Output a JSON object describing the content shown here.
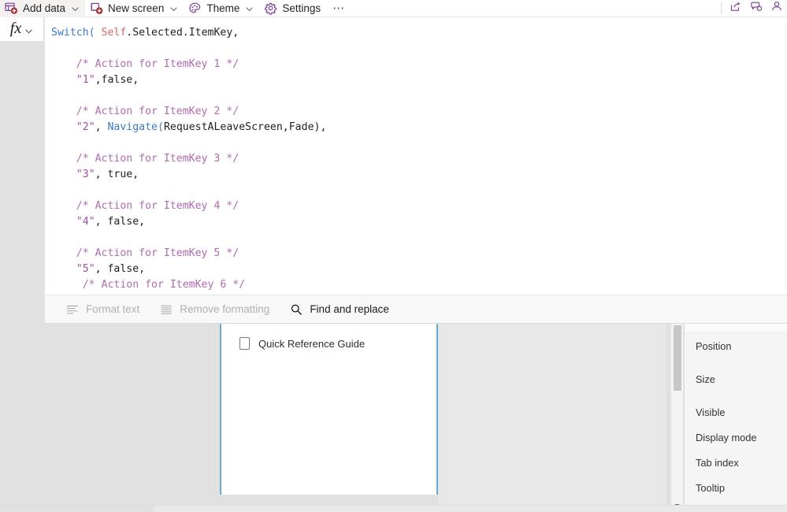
{
  "commandbar": {
    "items": [
      {
        "label": "Add data",
        "icon": "add-data-icon",
        "has_chevron": true
      },
      {
        "label": "New screen",
        "icon": "new-screen-icon",
        "has_chevron": true
      },
      {
        "label": "Theme",
        "icon": "theme-palette-icon",
        "has_chevron": true
      },
      {
        "label": "Settings",
        "icon": "settings-gear-icon",
        "has_chevron": false
      }
    ],
    "overflow": "⋯",
    "right_icons": [
      {
        "name": "share-icon"
      },
      {
        "name": "comments-icon"
      },
      {
        "name": "account-icon"
      }
    ]
  },
  "formula_bar": {
    "fx_label": "fx",
    "expand_chevron": "chevron-down-icon",
    "lines": [
      [
        {
          "t": "Switch(",
          "c": "fn"
        },
        {
          "t": " ",
          "c": "plain"
        },
        {
          "t": "Self",
          "c": "self"
        },
        {
          "t": ".Selected.ItemKey,",
          "c": "plain"
        }
      ],
      [],
      [
        {
          "t": "    /* Action for ItemKey 1 */",
          "c": "cmt"
        }
      ],
      [
        {
          "t": "    ",
          "c": "plain"
        },
        {
          "t": "\"1\"",
          "c": "str"
        },
        {
          "t": ",false,",
          "c": "plain"
        }
      ],
      [],
      [
        {
          "t": "    /* Action for ItemKey 2 */",
          "c": "cmt"
        }
      ],
      [
        {
          "t": "    ",
          "c": "plain"
        },
        {
          "t": "\"2\"",
          "c": "str"
        },
        {
          "t": ", ",
          "c": "plain"
        },
        {
          "t": "Navigate(",
          "c": "fn"
        },
        {
          "t": "RequestALeaveScreen,Fade),",
          "c": "plain"
        }
      ],
      [],
      [
        {
          "t": "    /* Action for ItemKey 3 */",
          "c": "cmt"
        }
      ],
      [
        {
          "t": "    ",
          "c": "plain"
        },
        {
          "t": "\"3\"",
          "c": "str"
        },
        {
          "t": ", true,",
          "c": "plain"
        }
      ],
      [],
      [
        {
          "t": "    /* Action for ItemKey 4 */",
          "c": "cmt"
        }
      ],
      [
        {
          "t": "    ",
          "c": "plain"
        },
        {
          "t": "\"4\"",
          "c": "str"
        },
        {
          "t": ", false,",
          "c": "plain"
        }
      ],
      [],
      [
        {
          "t": "    /* Action for ItemKey 5 */",
          "c": "cmt"
        }
      ],
      [
        {
          "t": "    ",
          "c": "plain"
        },
        {
          "t": "\"5\"",
          "c": "str"
        },
        {
          "t": ", false,",
          "c": "plain"
        }
      ],
      [
        {
          "t": "     /* Action for ItemKey 6 */",
          "c": "cmt"
        }
      ]
    ]
  },
  "formula_toolbar": {
    "items": [
      {
        "label": "Format text",
        "icon": "format-text-icon",
        "enabled": false
      },
      {
        "label": "Remove formatting",
        "icon": "remove-formatting-icon",
        "enabled": false
      },
      {
        "label": "Find and replace",
        "icon": "search-icon",
        "enabled": true
      }
    ]
  },
  "canvas": {
    "control": {
      "type": "checkbox",
      "label": "Quick Reference Guide",
      "checked": false
    }
  },
  "properties_panel": {
    "items": [
      {
        "label": "Position"
      },
      {
        "label": "Size"
      },
      {
        "label": "Visible"
      },
      {
        "label": "Display mode"
      },
      {
        "label": "Tab index"
      },
      {
        "label": "Tooltip"
      }
    ]
  },
  "colors": {
    "brand_purple": "#7a3e99",
    "selection_blue": "#6ea8cd",
    "code_function": "#3b78c3",
    "code_self": "#d2686b",
    "code_comment": "#b06ab0",
    "code_string": "#a24ba2",
    "app_background": "#e1e1e1"
  }
}
